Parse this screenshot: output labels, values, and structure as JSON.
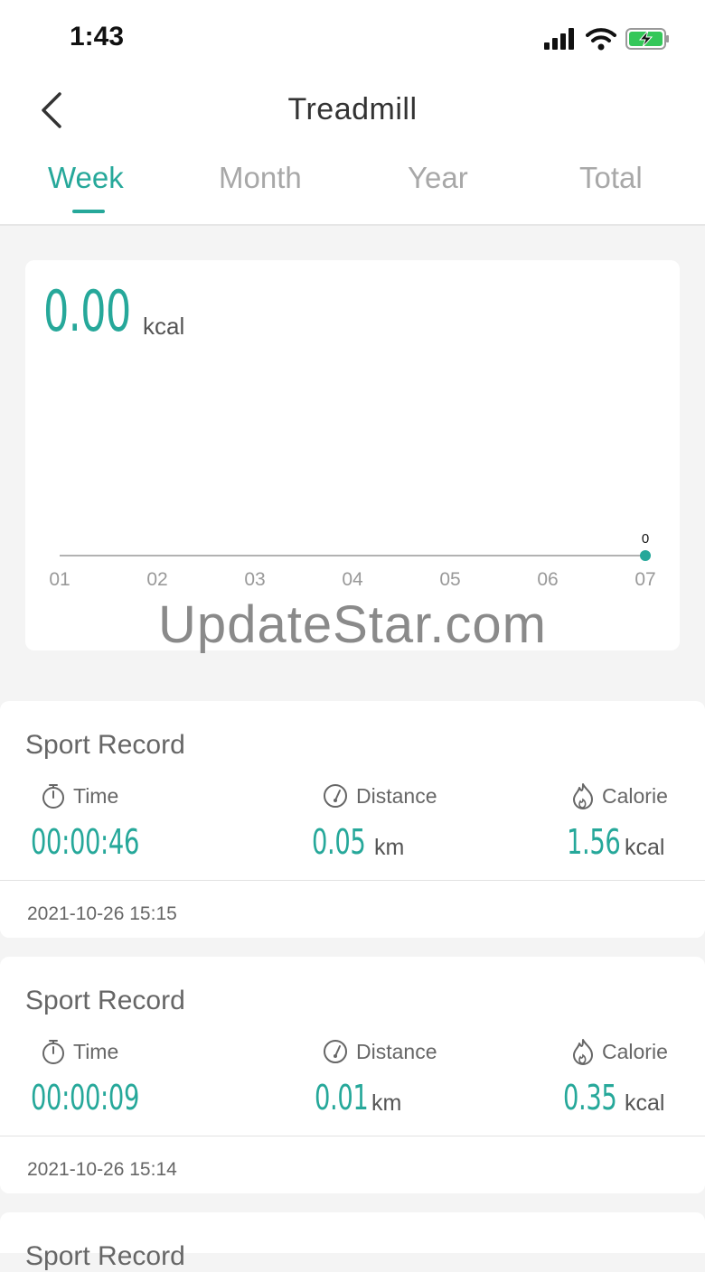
{
  "status_bar": {
    "time": "1:43"
  },
  "nav": {
    "title": "Treadmill"
  },
  "tabs": [
    {
      "label": "Week",
      "active": true
    },
    {
      "label": "Month",
      "active": false
    },
    {
      "label": "Year",
      "active": false
    },
    {
      "label": "Total",
      "active": false
    }
  ],
  "summary": {
    "value": "0.00",
    "unit": "kcal"
  },
  "chart_data": {
    "type": "line",
    "categories": [
      "01",
      "02",
      "03",
      "04",
      "05",
      "06",
      "07"
    ],
    "series": [
      {
        "values": [
          null,
          null,
          null,
          null,
          null,
          null,
          0
        ]
      }
    ],
    "point_labels": [
      "0"
    ],
    "colors": {
      "line": "#26a89a",
      "axis": "#999999"
    }
  },
  "watermark": "UpdateStar.com",
  "records": [
    {
      "title": "Sport Record",
      "time_label": "Time",
      "time_value": "00:00:46",
      "distance_label": "Distance",
      "distance_value": "0.05",
      "distance_unit": "km",
      "calorie_label": "Calorie",
      "calorie_value": "1.56",
      "calorie_unit": "kcal",
      "date": "2021-10-26 15:15"
    },
    {
      "title": "Sport Record",
      "time_label": "Time",
      "time_value": "00:00:09",
      "distance_label": "Distance",
      "distance_value": "0.01",
      "distance_unit": "km",
      "calorie_label": "Calorie",
      "calorie_value": "0.35",
      "calorie_unit": "kcal",
      "date": "2021-10-26 15:14"
    },
    {
      "title": "Sport Record"
    }
  ],
  "colors": {
    "accent": "#26a89a",
    "background": "#f4f4f4"
  }
}
